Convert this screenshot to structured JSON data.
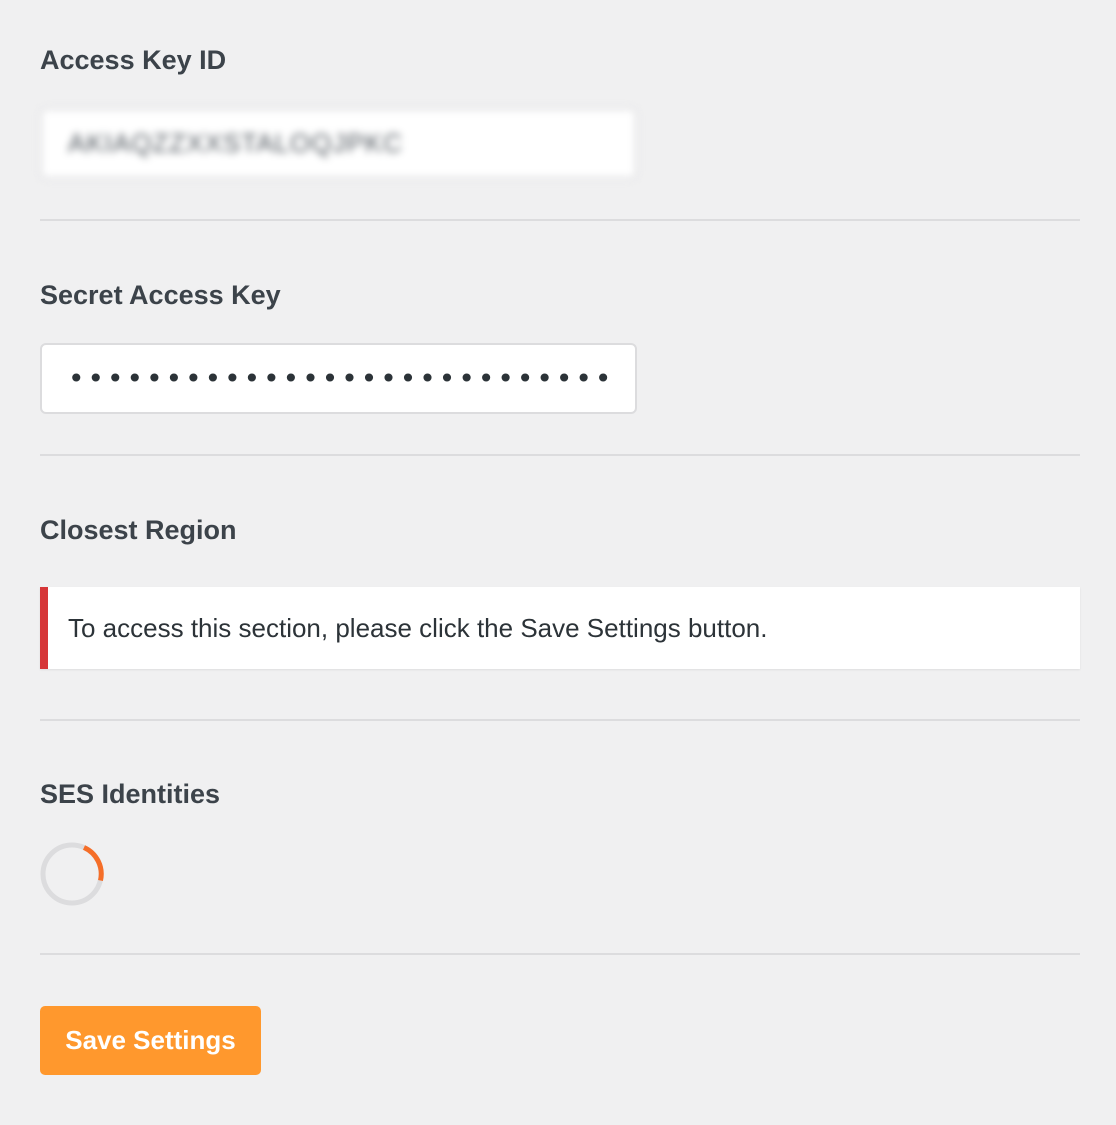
{
  "fields": {
    "access_key_id": {
      "label": "Access Key ID",
      "value": "AKIAQZZXXSTALOQJPKC"
    },
    "secret_access_key": {
      "label": "Secret Access Key",
      "value": "••••••••••••••••••••••••••••••••••••••••"
    }
  },
  "closest_region": {
    "label": "Closest Region",
    "notice": "To access this section, please click the Save Settings button.",
    "notice_color": "#d63638"
  },
  "ses_identities": {
    "label": "SES Identities",
    "spinner_icon": "loading-spinner-icon",
    "spinner_color": "#f56e28"
  },
  "actions": {
    "save_label": "Save Settings",
    "save_color": "#ff982d"
  }
}
